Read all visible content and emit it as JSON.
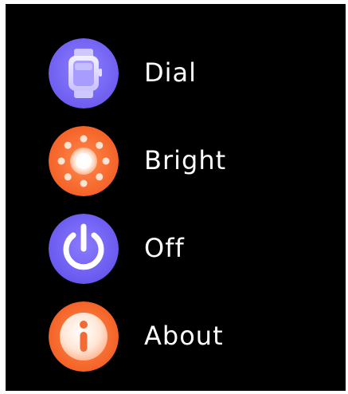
{
  "menu": {
    "items": [
      {
        "id": "dial",
        "label": "Dial",
        "icon": "smartwatch-icon",
        "icon_bg": "#7B6CF2",
        "icon_fg": "#D9D3FF"
      },
      {
        "id": "bright",
        "label": "Bright",
        "icon": "sun-icon",
        "icon_bg": "#F6692F",
        "icon_fg": "#FFE3D2"
      },
      {
        "id": "off",
        "label": "Off",
        "icon": "power-icon",
        "icon_bg": "#7663F0",
        "icon_fg": "#FFFFFF"
      },
      {
        "id": "about",
        "label": "About",
        "icon": "info-icon",
        "icon_bg": "#F6692F",
        "icon_fg": "#FFE3D2"
      }
    ]
  }
}
